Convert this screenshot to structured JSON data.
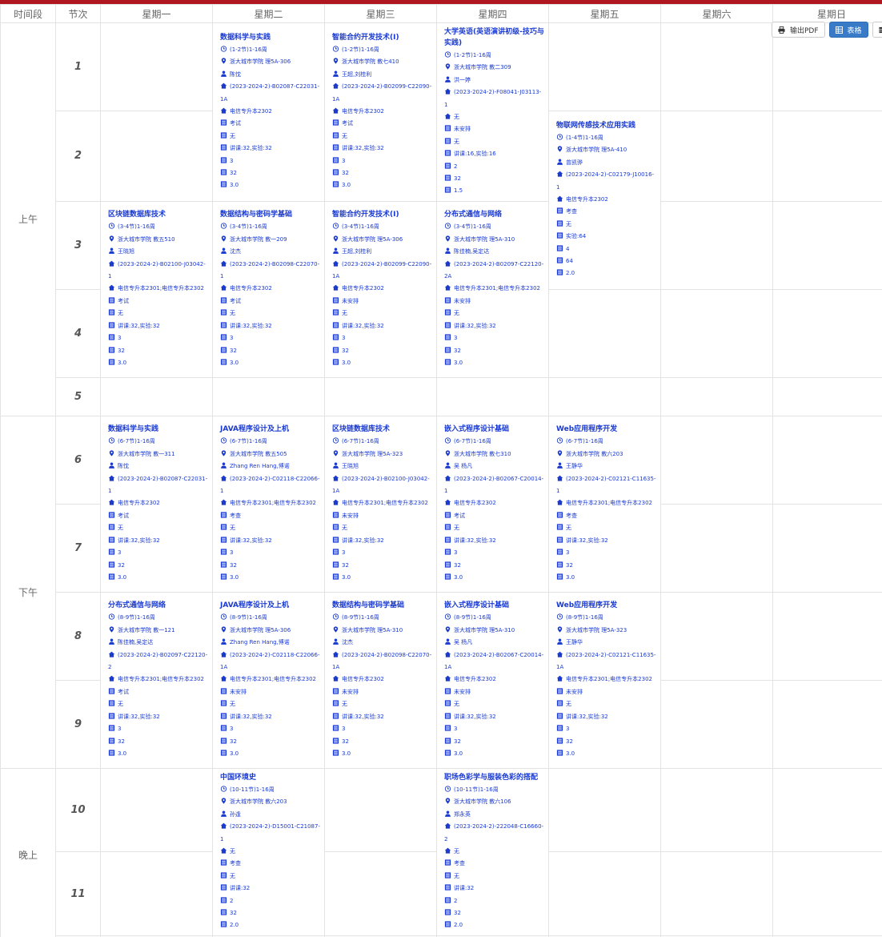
{
  "header": {
    "period": "时间段",
    "section": "节次",
    "days": [
      "星期一",
      "星期二",
      "星期三",
      "星期四",
      "星期五",
      "星期六",
      "星期日"
    ]
  },
  "periods": [
    "上午",
    "下午",
    "晚上"
  ],
  "sections": [
    "1",
    "2",
    "3",
    "4",
    "5",
    "6",
    "7",
    "8",
    "9",
    "10",
    "11"
  ],
  "toolbar": {
    "pdf_label": "输出PDF",
    "table_label": "表格"
  },
  "colors": {
    "accent_bar": "#b0161f",
    "course_text": "#1a3ad0",
    "button_active": "#3a7bc8"
  },
  "line_icons": [
    "clock-icon",
    "location-icon",
    "teacher-icon",
    "class-code-icon",
    "major-icon",
    "assessment-icon",
    "note-icon",
    "hours-icon",
    "count-icon",
    "count-icon",
    "credit-icon"
  ],
  "courses": [
    {
      "day": 1,
      "start": 1,
      "span": 2,
      "title": "数据科学与实践",
      "lines": [
        "(1-2节)1-16周",
        "浙大城市学院 理5A-306",
        "陈忱",
        "(2023-2024-2)-B02087-C22031-1A",
        "电信专升本2302",
        "考试",
        "无",
        "讲课:32,实验:32",
        "3",
        "32",
        "3.0"
      ]
    },
    {
      "day": 2,
      "start": 1,
      "span": 2,
      "title": "智能合约开发技术(Ⅰ)",
      "lines": [
        "(1-2节)1-16周",
        "浙大城市学院 教七410",
        "王超,刘桂利",
        "(2023-2024-2)-B02099-C22090-1A",
        "电信专升本2302",
        "考试",
        "无",
        "讲课:32,实验:32",
        "3",
        "32",
        "3.0"
      ]
    },
    {
      "day": 3,
      "start": 1,
      "span": 2,
      "title": "大学英语(英语演讲初级-技巧与实践)",
      "lines": [
        "(1-2节)1-16周",
        "浙大城市学院 教二309",
        "洪一婷",
        "(2023-2024-2)-F08041-J03113-1",
        "无",
        "未安排",
        "无",
        "讲课:16,实验:16",
        "2",
        "32",
        "1.5"
      ]
    },
    {
      "day": 4,
      "start": 2,
      "span": 2,
      "title": "物联网传感技术应用实践",
      "lines": [
        "(1-4节)1-16周",
        "浙大城市学院 理5A-410",
        "曾凯骅",
        "(2023-2024-2)-C02179-J10016-1",
        "电信专升本2302",
        "考查",
        "无",
        "实验:64",
        "4",
        "64",
        "2.0"
      ]
    },
    {
      "day": 0,
      "start": 3,
      "span": 2,
      "title": "区块链数据库技术",
      "lines": [
        "(3-4节)1-16周",
        "浙大城市学院 教五510",
        "王晓旭",
        "(2023-2024-2)-B02100-J03042-1",
        "电信专升本2301;电信专升本2302",
        "考试",
        "无",
        "讲课:32,实验:32",
        "3",
        "32",
        "3.0"
      ]
    },
    {
      "day": 1,
      "start": 3,
      "span": 2,
      "title": "数据结构与密码学基础",
      "lines": [
        "(3-4节)1-16周",
        "浙大城市学院 教一209",
        "沈杰",
        "(2023-2024-2)-B02098-C22070-1",
        "电信专升本2302",
        "考试",
        "无",
        "讲课:32,实验:32",
        "3",
        "32",
        "3.0"
      ]
    },
    {
      "day": 2,
      "start": 3,
      "span": 2,
      "title": "智能合约开发技术(Ⅰ)",
      "lines": [
        "(3-4节)1-16周",
        "浙大城市学院 理5A-306",
        "王超,刘桂利",
        "(2023-2024-2)-B02099-C22090-1A",
        "电信专升本2302",
        "未安排",
        "无",
        "讲课:32,实验:32",
        "3",
        "32",
        "3.0"
      ]
    },
    {
      "day": 3,
      "start": 3,
      "span": 2,
      "title": "分布式通信与网络",
      "lines": [
        "(3-4节)1-16周",
        "浙大城市学院 理5A-310",
        "陈佳楠,吴定达",
        "(2023-2024-2)-B02097-C22120-2A",
        "电信专升本2301;电信专升本2302",
        "未安排",
        "无",
        "讲课:32,实验:32",
        "3",
        "32",
        "3.0"
      ]
    },
    {
      "day": 0,
      "start": 6,
      "span": 2,
      "title": "数据科学与实践",
      "lines": [
        "(6-7节)1-16周",
        "浙大城市学院 教一311",
        "陈忱",
        "(2023-2024-2)-B02087-C22031-1",
        "电信专升本2302",
        "考试",
        "无",
        "讲课:32,实验:32",
        "3",
        "32",
        "3.0"
      ]
    },
    {
      "day": 1,
      "start": 6,
      "span": 2,
      "title": "JAVA程序设计及上机",
      "lines": [
        "(6-7节)1-16周",
        "浙大城市学院 教五505",
        "Zhang Ren Hang,博诺",
        "(2023-2024-2)-C02118-C22066-1",
        "电信专升本2301;电信专升本2302",
        "考查",
        "无",
        "讲课:32,实验:32",
        "3",
        "32",
        "3.0"
      ]
    },
    {
      "day": 2,
      "start": 6,
      "span": 2,
      "title": "区块链数据库技术",
      "lines": [
        "(6-7节)1-16周",
        "浙大城市学院 理5A-323",
        "王晓旭",
        "(2023-2024-2)-B02100-J03042-1A",
        "电信专升本2301;电信专升本2302",
        "未安排",
        "无",
        "讲课:32,实验:32",
        "3",
        "32",
        "3.0"
      ]
    },
    {
      "day": 3,
      "start": 6,
      "span": 2,
      "title": "嵌入式程序设计基础",
      "lines": [
        "(6-7节)1-16周",
        "浙大城市学院 教七310",
        "吴 杨凡",
        "(2023-2024-2)-B02067-C20014-1",
        "电信专升本2302",
        "考试",
        "无",
        "讲课:32,实验:32",
        "3",
        "32",
        "3.0"
      ]
    },
    {
      "day": 4,
      "start": 6,
      "span": 2,
      "title": "Web应用程序开发",
      "lines": [
        "(6-7节)1-16周",
        "浙大城市学院 教六203",
        "王静华",
        "(2023-2024-2)-C02121-C11635-1",
        "电信专升本2301;电信专升本2302",
        "考查",
        "无",
        "讲课:32,实验:32",
        "3",
        "32",
        "3.0"
      ]
    },
    {
      "day": 0,
      "start": 8,
      "span": 2,
      "title": "分布式通信与网络",
      "lines": [
        "(8-9节)1-16周",
        "浙大城市学院 教一121",
        "陈佳楠,吴定达",
        "(2023-2024-2)-B02097-C22120-2",
        "电信专升本2301;电信专升本2302",
        "考试",
        "无",
        "讲课:32,实验:32",
        "3",
        "32",
        "3.0"
      ]
    },
    {
      "day": 1,
      "start": 8,
      "span": 2,
      "title": "JAVA程序设计及上机",
      "lines": [
        "(8-9节)1-16周",
        "浙大城市学院 理5A-306",
        "Zhang Ren Hang,博诺",
        "(2023-2024-2)-C02118-C22066-1A",
        "电信专升本2301;电信专升本2302",
        "未安排",
        "无",
        "讲课:32,实验:32",
        "3",
        "32",
        "3.0"
      ]
    },
    {
      "day": 2,
      "start": 8,
      "span": 2,
      "title": "数据结构与密码学基础",
      "lines": [
        "(8-9节)1-16周",
        "浙大城市学院 理5A-310",
        "沈杰",
        "(2023-2024-2)-B02098-C22070-1A",
        "电信专升本2302",
        "未安排",
        "无",
        "讲课:32,实验:32",
        "3",
        "32",
        "3.0"
      ]
    },
    {
      "day": 3,
      "start": 8,
      "span": 2,
      "title": "嵌入式程序设计基础",
      "lines": [
        "(8-9节)1-16周",
        "浙大城市学院 理5A-310",
        "吴 杨凡",
        "(2023-2024-2)-B02067-C20014-1A",
        "电信专升本2302",
        "未安排",
        "无",
        "讲课:32,实验:32",
        "3",
        "32",
        "3.0"
      ]
    },
    {
      "day": 4,
      "start": 8,
      "span": 2,
      "title": "Web应用程序开发",
      "lines": [
        "(8-9节)1-16周",
        "浙大城市学院 理5A-323",
        "王静华",
        "(2023-2024-2)-C02121-C11635-1A",
        "电信专升本2301;电信专升本2302",
        "未安排",
        "无",
        "讲课:32,实验:32",
        "3",
        "32",
        "3.0"
      ]
    },
    {
      "day": 1,
      "start": 10,
      "span": 2,
      "title": "中国环境史",
      "lines": [
        "(10-11节)1-16周",
        "浙大城市学院 教六203",
        "孙逢",
        "(2023-2024-2)-D15001-C21087-1",
        "无",
        "考查",
        "无",
        "讲课:32",
        "2",
        "32",
        "2.0"
      ]
    },
    {
      "day": 3,
      "start": 10,
      "span": 2,
      "title": "职场色彩学与服装色彩的搭配",
      "lines": [
        "(10-11节)1-16周",
        "浙大城市学院 教六106",
        "郑永英",
        "(2023-2024-2)-222048-C16660-2",
        "无",
        "考查",
        "无",
        "讲课:32",
        "2",
        "32",
        "2.0"
      ]
    }
  ]
}
